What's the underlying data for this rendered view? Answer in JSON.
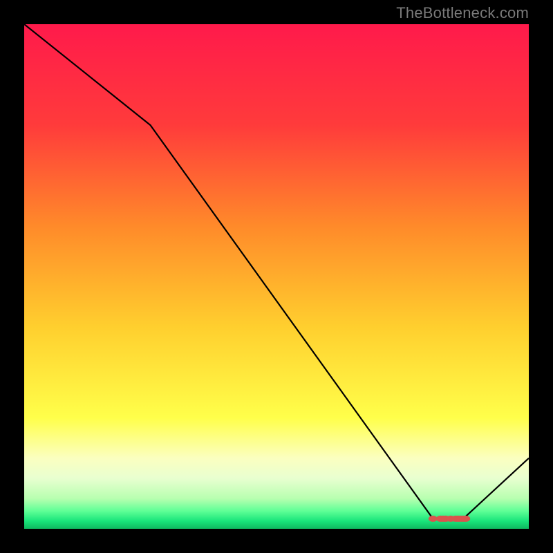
{
  "attribution": "TheBottleneck.com",
  "chart_data": {
    "type": "line",
    "title": "",
    "xlabel": "",
    "ylabel": "",
    "xlim": [
      0,
      100
    ],
    "ylim": [
      0,
      100
    ],
    "x": [
      0,
      25,
      81,
      87,
      100
    ],
    "values": [
      100,
      80,
      2,
      2,
      14
    ],
    "markers_x": [
      81,
      82.5,
      83,
      83.5,
      84.5,
      85.5,
      86,
      86.5,
      87,
      87.5
    ],
    "markers_y": [
      2,
      2,
      2,
      2,
      2,
      2,
      2,
      2,
      2,
      2
    ],
    "gradient_stops": [
      {
        "offset": 0,
        "color": "#ff1a4b"
      },
      {
        "offset": 0.2,
        "color": "#ff3b3b"
      },
      {
        "offset": 0.4,
        "color": "#ff8a2a"
      },
      {
        "offset": 0.6,
        "color": "#ffcf2e"
      },
      {
        "offset": 0.78,
        "color": "#ffff4a"
      },
      {
        "offset": 0.86,
        "color": "#fbffc0"
      },
      {
        "offset": 0.9,
        "color": "#e8ffd0"
      },
      {
        "offset": 0.94,
        "color": "#b8ffb0"
      },
      {
        "offset": 0.965,
        "color": "#5eff96"
      },
      {
        "offset": 0.985,
        "color": "#18e47a"
      },
      {
        "offset": 1.0,
        "color": "#0fb85f"
      }
    ],
    "line_color": "#000000",
    "marker_color": "#d9544d"
  }
}
